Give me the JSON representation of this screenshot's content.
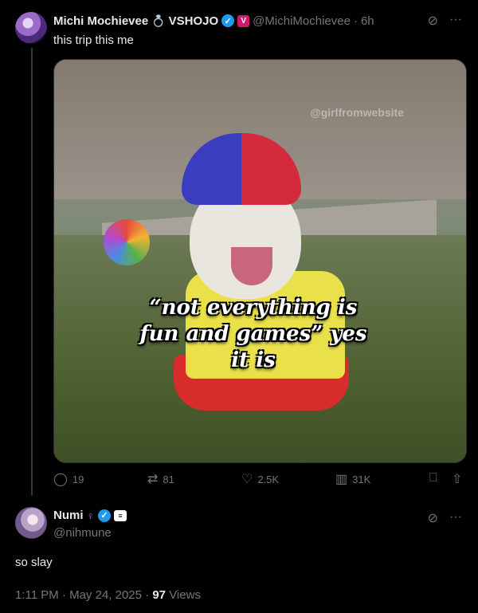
{
  "post": {
    "author_name": "Michi Mochievee",
    "affiliation": "VSHOJO",
    "handle": "@MichiMochievee",
    "time": "6h",
    "text": "this trip this me",
    "media": {
      "watermark": "@girlfromwebsite",
      "caption_line1": "“not everything is",
      "caption_line2": "fun and games” yes",
      "caption_line3": "it is"
    },
    "stats": {
      "replies": "19",
      "reposts": "81",
      "likes": "2.5K",
      "views": "31K"
    }
  },
  "reply": {
    "author_name": "Numi",
    "handle": "@nihmune",
    "text": "so slay",
    "time": "1:11 PM",
    "date": "May 24, 2025",
    "views_count": "97",
    "views_label": "Views"
  },
  "icons": {
    "more": "more-icon",
    "grok": "grok-icon",
    "reply": "reply-icon",
    "repost": "repost-icon",
    "like": "like-icon",
    "views": "views-icon",
    "bookmark": "bookmark-icon",
    "share": "share-icon"
  },
  "colors": {
    "accent": "#1d9bf0",
    "background": "#000000",
    "muted": "#71767b"
  }
}
